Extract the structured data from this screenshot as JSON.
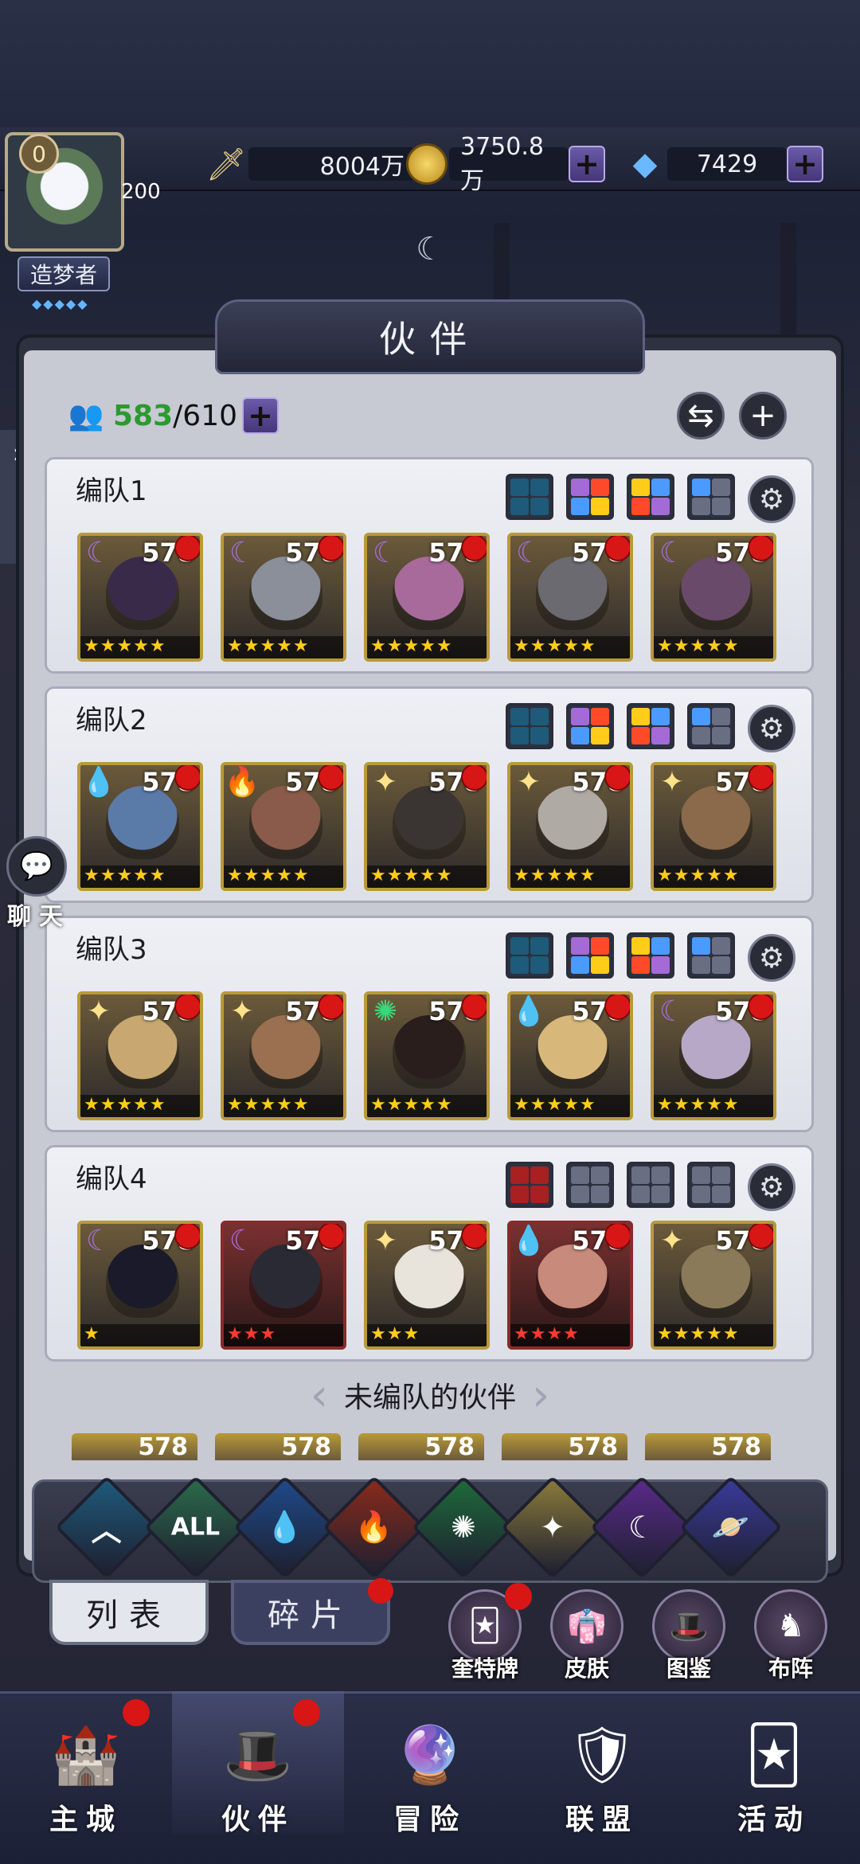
{
  "player": {
    "level": "0",
    "power_suffix": "200",
    "title": "造梦者"
  },
  "resources": {
    "attack": "8004万",
    "gold": "3750.8万",
    "diamond": "7429"
  },
  "page_title": "伙伴",
  "partner_count": {
    "current": "583",
    "max": "/610"
  },
  "teams": [
    {
      "name": "编队1",
      "heroes": [
        {
          "level": "578",
          "element": "moon",
          "color": "#a46ad8",
          "face": "#3a2a4a",
          "stars": "★★★★★",
          "frame": "gold"
        },
        {
          "level": "578",
          "element": "moon",
          "color": "#a46ad8",
          "face": "#8a8f9a",
          "stars": "★★★★★",
          "frame": "gold"
        },
        {
          "level": "578",
          "element": "moon",
          "color": "#a46ad8",
          "face": "#a86a9a",
          "stars": "★★★★★",
          "frame": "gold"
        },
        {
          "level": "578",
          "element": "moon",
          "color": "#a46ad8",
          "face": "#6a6a70",
          "stars": "★★★★★",
          "frame": "gold"
        },
        {
          "level": "578",
          "element": "moon",
          "color": "#a46ad8",
          "face": "#6a4a6a",
          "stars": "★★★★★",
          "frame": "gold"
        }
      ]
    },
    {
      "name": "编队2",
      "heroes": [
        {
          "level": "578",
          "element": "water",
          "color": "#4a9aff",
          "face": "#5a7aa8",
          "stars": "★★★★★",
          "frame": "gold"
        },
        {
          "level": "578",
          "element": "fire",
          "color": "#ff4a2a",
          "face": "#8a5a4a",
          "stars": "★★★★★",
          "frame": "gold"
        },
        {
          "level": "578",
          "element": "light",
          "color": "#ffe28a",
          "face": "#3a3432",
          "stars": "★★★★★",
          "frame": "gold"
        },
        {
          "level": "578",
          "element": "light",
          "color": "#ffe28a",
          "face": "#b0aaa4",
          "stars": "★★★★★",
          "frame": "gold"
        },
        {
          "level": "578",
          "element": "light",
          "color": "#ffe28a",
          "face": "#8a6a4a",
          "stars": "★★★★★",
          "frame": "gold"
        }
      ]
    },
    {
      "name": "编队3",
      "heroes": [
        {
          "level": "578",
          "element": "light",
          "color": "#ffe28a",
          "face": "#c8a870",
          "stars": "★★★★★",
          "frame": "gold"
        },
        {
          "level": "578",
          "element": "light",
          "color": "#ffe28a",
          "face": "#9a7050",
          "stars": "★★★★★",
          "frame": "gold"
        },
        {
          "level": "578",
          "element": "wind",
          "color": "#3ad87a",
          "face": "#2a1e1c",
          "stars": "★★★★★",
          "frame": "gold"
        },
        {
          "level": "578",
          "element": "water",
          "color": "#4a9aff",
          "face": "#d8b87a",
          "stars": "★★★★★",
          "frame": "gold"
        },
        {
          "level": "578",
          "element": "moon",
          "color": "#a46ad8",
          "face": "#b8a8c8",
          "stars": "★★★★★",
          "frame": "gold"
        }
      ]
    },
    {
      "name": "编队4",
      "heroes": [
        {
          "level": "578",
          "element": "moon",
          "color": "#a46ad8",
          "face": "#1a1a2a",
          "stars": "★",
          "frame": "gold"
        },
        {
          "level": "578",
          "element": "moon",
          "color": "#a46ad8",
          "face": "#2a2a34",
          "stars": "★★★",
          "frame": "red"
        },
        {
          "level": "578",
          "element": "light",
          "color": "#ffe28a",
          "face": "#e8e4dc",
          "stars": "★★★",
          "frame": "gold"
        },
        {
          "level": "578",
          "element": "water",
          "color": "#4a9aff",
          "face": "#c88a7a",
          "stars": "★★★★",
          "frame": "red"
        },
        {
          "level": "578",
          "element": "light",
          "color": "#ffe28a",
          "face": "#8a7a5a",
          "stars": "★★★★★",
          "frame": "gold"
        }
      ]
    }
  ],
  "unassigned_label": "未编队的伙伴",
  "unassigned_levels": [
    "578",
    "578",
    "578",
    "578",
    "578"
  ],
  "filters": [
    "",
    "ALL",
    "",
    "",
    "",
    "",
    "",
    ""
  ],
  "tabs": {
    "list": "列表",
    "fragments": "碎片"
  },
  "side_buttons": {
    "tarot": "奎特牌",
    "skin": "皮肤",
    "codex": "图鉴",
    "formation": "布阵"
  },
  "chat": "聊天",
  "nav": [
    "主城",
    "伙伴",
    "冒险",
    "联盟",
    "活动"
  ],
  "colors": {
    "accent_green": "#2c9a2f",
    "badge_red": "#d81616",
    "gold_frame": "#b89a38"
  }
}
